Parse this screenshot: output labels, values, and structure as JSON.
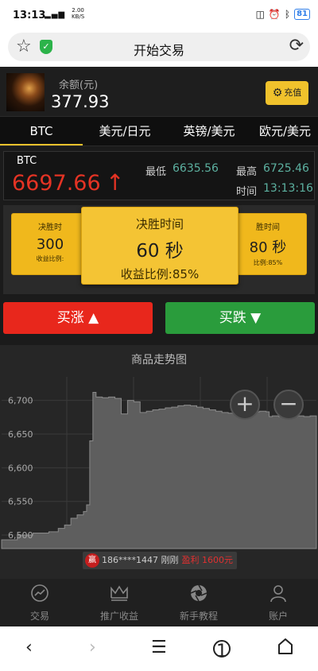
{
  "status": {
    "time": "13:13",
    "signal": "4G",
    "speed_top": "2.00",
    "speed_bottom": "KB/S",
    "battery": "81"
  },
  "browser": {
    "title": "开始交易"
  },
  "account": {
    "balance_label": "余额(元)",
    "balance": "377.93",
    "recharge": "充值"
  },
  "tabs": [
    "BTC",
    "美元/日元",
    "英镑/美元",
    "欧元/美元"
  ],
  "quote": {
    "symbol": "BTC",
    "price": "6697.66",
    "arrow": "↑",
    "low_label": "最低",
    "low": "6635.56",
    "high_label": "最高",
    "high": "6725.46",
    "time_label": "时间",
    "time": "13:13:16"
  },
  "cards": {
    "left": {
      "title": "决胜时",
      "seconds": "300",
      "rate": "收益比例:"
    },
    "main": {
      "title": "决胜时间",
      "seconds": "60 秒",
      "rate": "收益比例:85%"
    },
    "right": {
      "title": "胜时间",
      "seconds": "80 秒",
      "rate": "比例:85%"
    }
  },
  "buttons": {
    "up": "买涨 ▲",
    "down": "买跌 ▼"
  },
  "chart_title": "商品走势图",
  "chart_data": {
    "type": "area",
    "title": "商品走势图",
    "yticks": [
      6700,
      6650,
      6600,
      6550,
      6500
    ],
    "ylim": [
      6480,
      6735
    ],
    "xlim": [
      0,
      100
    ],
    "x": [
      0,
      5,
      10,
      15,
      18,
      20,
      22,
      24,
      26,
      27,
      28,
      29,
      30,
      32,
      34,
      36,
      38,
      40,
      42,
      44,
      46,
      48,
      50,
      52,
      54,
      56,
      58,
      60,
      62,
      64,
      66,
      68,
      70,
      72,
      74,
      76,
      78,
      80,
      82,
      84,
      85,
      86,
      88,
      90,
      92,
      94,
      96,
      98,
      100
    ],
    "y": [
      6493,
      6500,
      6503,
      6505,
      6510,
      6515,
      6525,
      6530,
      6535,
      6545,
      6640,
      6712,
      6705,
      6704,
      6705,
      6703,
      6680,
      6700,
      6698,
      6682,
      6684,
      6686,
      6687,
      6689,
      6690,
      6692,
      6693,
      6692,
      6690,
      6688,
      6686,
      6684,
      6682,
      6681,
      6682,
      6683,
      6684,
      6683,
      6684,
      6683,
      6676,
      6677,
      6676,
      6677,
      6676,
      6677,
      6676,
      6677,
      6676
    ],
    "grid": true
  },
  "ticker": {
    "badge": "赢",
    "user": "186****1447 刚刚",
    "win": "盈利 1600元"
  },
  "nav": [
    {
      "label": "交易",
      "icon": "chart-icon"
    },
    {
      "label": "推广收益",
      "icon": "crown-icon"
    },
    {
      "label": "新手教程",
      "icon": "aperture-icon"
    },
    {
      "label": "账户",
      "icon": "user-icon"
    }
  ],
  "sysnav": {
    "tabs_count": "1"
  }
}
